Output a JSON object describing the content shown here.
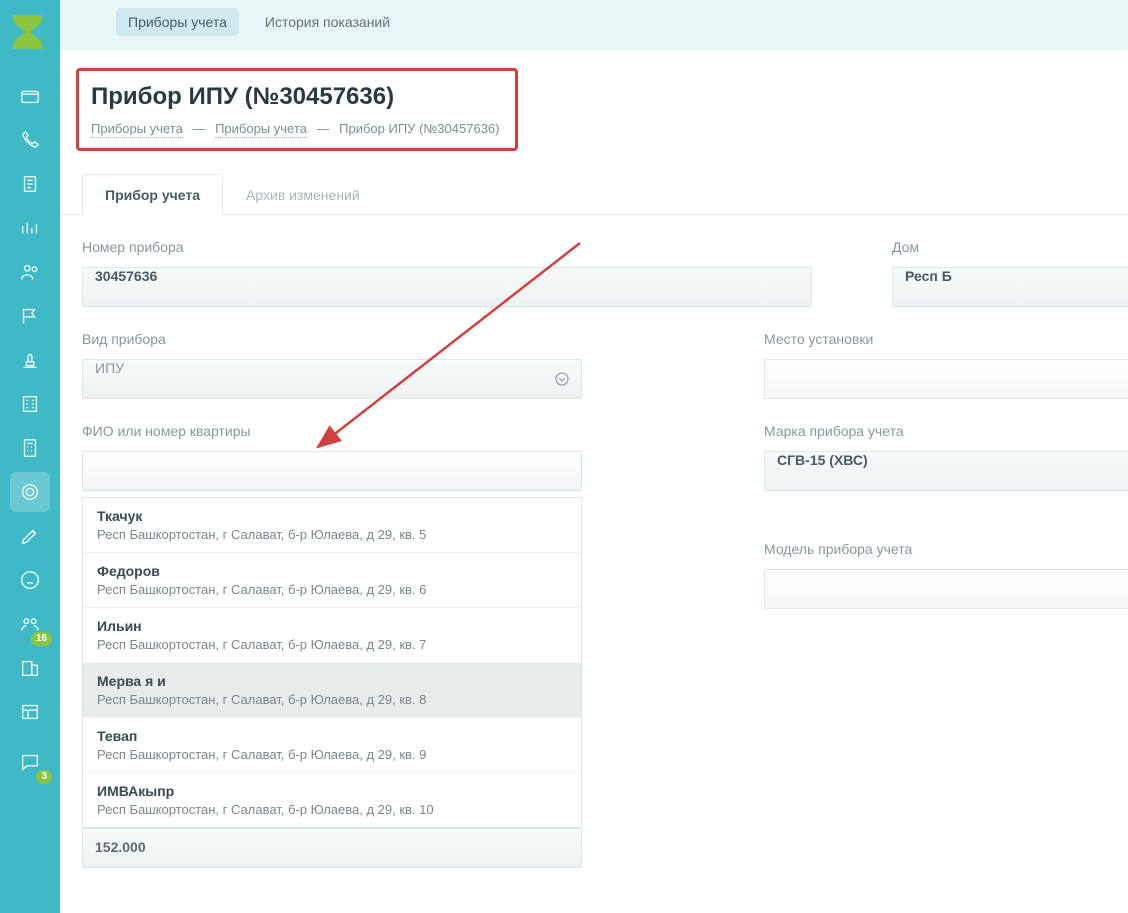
{
  "topnav": {
    "items": [
      {
        "label": "Приборы учета",
        "active": true
      },
      {
        "label": "История показаний",
        "active": false
      }
    ]
  },
  "title": "Прибор ИПУ (№30457636)",
  "breadcrumb": {
    "a": "Приборы учета",
    "b": "Приборы учета",
    "c": "Прибор ИПУ (№30457636)"
  },
  "tabs": [
    {
      "label": "Прибор учета",
      "active": true
    },
    {
      "label": "Архив изменений",
      "active": false
    }
  ],
  "fields": {
    "number_label": "Номер прибора",
    "number_value": "30457636",
    "house_label": "Дом",
    "house_value": "Респ Б",
    "type_label": "Вид прибора",
    "type_value": "ИПУ",
    "place_label": "Место установки",
    "place_value": "",
    "fio_label": "ФИО или номер квартиры",
    "brand_label": "Марка прибора учета",
    "brand_value": "СГВ-15 (ХВС)",
    "model_label": "Модель прибора учета",
    "model_value": "",
    "bottom_value": "152.000"
  },
  "dropdown": [
    {
      "name": "Ткачук",
      "addr": "Респ Башкортостан, г Салават, б-р Юлаева, д 29, кв. 5"
    },
    {
      "name": "Федоров",
      "addr": "Респ Башкортостан, г Салават, б-р Юлаева, д 29, кв. 6"
    },
    {
      "name": "Ильин",
      "addr": "Респ Башкортостан, г Салават, б-р Юлаева, д 29, кв. 7"
    },
    {
      "name": "Мерва я и",
      "addr": "Респ Башкортостан, г Салават, б-р Юлаева, д 29, кв. 8",
      "hover": true
    },
    {
      "name": "Тевап",
      "addr": "Респ Башкортостан, г Салават, б-р Юлаева, д 29, кв. 9"
    },
    {
      "name": "ИМВАкыпр",
      "addr": "Респ Башкортостан, г Салават, б-р Юлаева, д 29, кв. 10"
    }
  ],
  "sidebar_badges": {
    "group": "16",
    "chat": "3"
  }
}
